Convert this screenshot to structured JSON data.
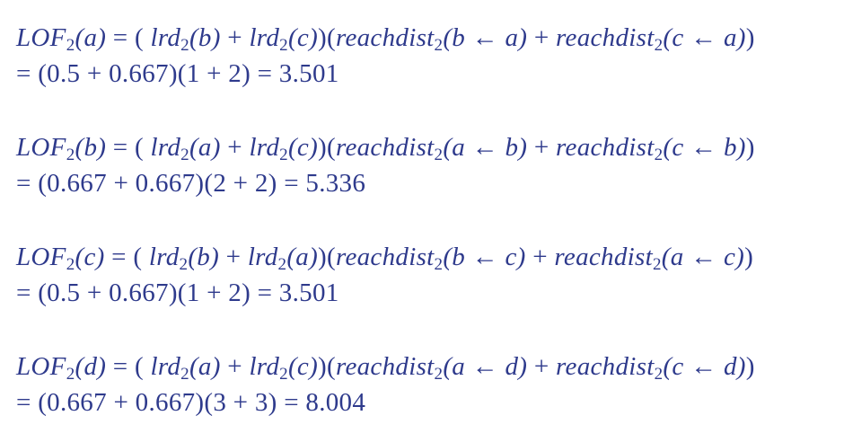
{
  "equations": [
    {
      "line1": [
        {
          "t": "LOF"
        },
        {
          "sub": "2"
        },
        {
          "t": "(a) "
        },
        {
          "u": "= ( "
        },
        {
          "t": "lrd"
        },
        {
          "sub": "2"
        },
        {
          "t": "(b) "
        },
        {
          "u": "+ "
        },
        {
          "t": "lrd"
        },
        {
          "sub": "2"
        },
        {
          "t": "(c)"
        },
        {
          "u": ")("
        },
        {
          "t": "reachdist"
        },
        {
          "sub": "2"
        },
        {
          "t": "(b "
        },
        {
          "u": "← "
        },
        {
          "t": "a) "
        },
        {
          "u": "+ "
        },
        {
          "t": "reachdist"
        },
        {
          "sub": "2"
        },
        {
          "t": "(c "
        },
        {
          "u": "← "
        },
        {
          "t": "a)"
        },
        {
          "u": ")"
        }
      ],
      "line2": "= (0.5 + 0.667)(1 + 2) = 3.501"
    },
    {
      "line1": [
        {
          "t": "LOF"
        },
        {
          "sub": "2"
        },
        {
          "t": "(b) "
        },
        {
          "u": "= ( "
        },
        {
          "t": "lrd"
        },
        {
          "sub": "2"
        },
        {
          "t": "(a) "
        },
        {
          "u": "+ "
        },
        {
          "t": "lrd"
        },
        {
          "sub": "2"
        },
        {
          "t": "(c)"
        },
        {
          "u": ")("
        },
        {
          "t": "reachdist"
        },
        {
          "sub": "2"
        },
        {
          "t": "(a "
        },
        {
          "u": "← "
        },
        {
          "t": "b) "
        },
        {
          "u": "+ "
        },
        {
          "t": "reachdist"
        },
        {
          "sub": "2"
        },
        {
          "t": "(c "
        },
        {
          "u": "← "
        },
        {
          "t": "b)"
        },
        {
          "u": ")"
        }
      ],
      "line2": "= (0.667 + 0.667)(2 + 2) = 5.336"
    },
    {
      "line1": [
        {
          "t": "LOF"
        },
        {
          "sub": "2"
        },
        {
          "t": "(c) "
        },
        {
          "u": "= ( "
        },
        {
          "t": "lrd"
        },
        {
          "sub": "2"
        },
        {
          "t": "(b) "
        },
        {
          "u": "+ "
        },
        {
          "t": "lrd"
        },
        {
          "sub": "2"
        },
        {
          "t": "(a)"
        },
        {
          "u": ")("
        },
        {
          "t": "reachdist"
        },
        {
          "sub": "2"
        },
        {
          "t": "(b "
        },
        {
          "u": "← "
        },
        {
          "t": "c) "
        },
        {
          "u": "+ "
        },
        {
          "t": "reachdist"
        },
        {
          "sub": "2"
        },
        {
          "t": "(a "
        },
        {
          "u": "← "
        },
        {
          "t": "c)"
        },
        {
          "u": ")"
        }
      ],
      "line2": "= (0.5 + 0.667)(1 + 2) = 3.501"
    },
    {
      "line1": [
        {
          "t": "LOF"
        },
        {
          "sub": "2"
        },
        {
          "t": "(d) "
        },
        {
          "u": "= ( "
        },
        {
          "t": "lrd"
        },
        {
          "sub": "2"
        },
        {
          "t": "(a) "
        },
        {
          "u": "+ "
        },
        {
          "t": "lrd"
        },
        {
          "sub": "2"
        },
        {
          "t": "(c)"
        },
        {
          "u": ")("
        },
        {
          "t": "reachdist"
        },
        {
          "sub": "2"
        },
        {
          "t": "(a "
        },
        {
          "u": "← "
        },
        {
          "t": "d) "
        },
        {
          "u": "+ "
        },
        {
          "t": "reachdist"
        },
        {
          "sub": "2"
        },
        {
          "t": "(c "
        },
        {
          "u": "← "
        },
        {
          "t": "d)"
        },
        {
          "u": ")"
        }
      ],
      "line2": "= (0.667 + 0.667)(3 + 3) = 8.004"
    }
  ]
}
